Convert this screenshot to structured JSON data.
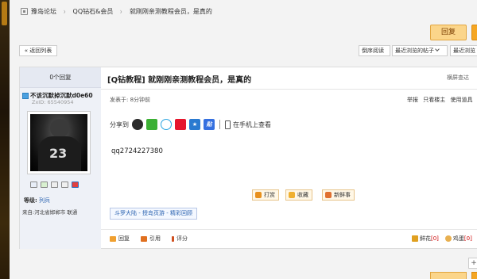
{
  "breadcrumb": {
    "items": [
      "豫岛论坛",
      "QQ钻石&会员",
      "就刚刚亲测教程会员，是真的"
    ]
  },
  "toolbar": {
    "reply_label": "回复",
    "back_label": "« 返回列表",
    "order_label": "倒序阅读",
    "prev_label": "最近浏览的帖子",
    "next_label": "最近浏览"
  },
  "author": {
    "reply_count": "0个回复",
    "name": "不该沉默掉沉默d0e60",
    "zx_id": "ZxID: 65540954",
    "grade_label": "等级:",
    "grade_value": "列兵",
    "location": "来自:河北省邯郸市 联通",
    "avatar_text": "23"
  },
  "post": {
    "title": "[Q钻教程] 就刚刚亲测教程会员，是真的",
    "view_mode": "横屏查达",
    "time": "发表于: 8分钟前",
    "tools": [
      "举报",
      "只看楼主",
      "使用道具"
    ],
    "share_label": "分享到",
    "mobile_label": "在手机上查看",
    "content": "qq2724227380",
    "actions": [
      "打赏",
      "收藏",
      "新鲜事"
    ],
    "tag": "斗罗大陆 - 授岛页游 - 精彩回顾",
    "bottom_left": [
      "回复",
      "引用",
      "评分"
    ],
    "flower_label": "鲜花",
    "flower_count": "[0]",
    "egg_label": "鸡蛋",
    "egg_count": "[0]"
  },
  "icons": [
    "home-icon",
    "qq-icon",
    "wechat-icon",
    "qzone-icon",
    "weibo-icon",
    "favorite-star-icon",
    "tieba-icon",
    "phone-icon"
  ],
  "colors": {
    "reply_button": "#fbd58a",
    "accent_orange": "#f5a623",
    "link_blue": "#2a62b0",
    "count_red": "#cc0000"
  }
}
